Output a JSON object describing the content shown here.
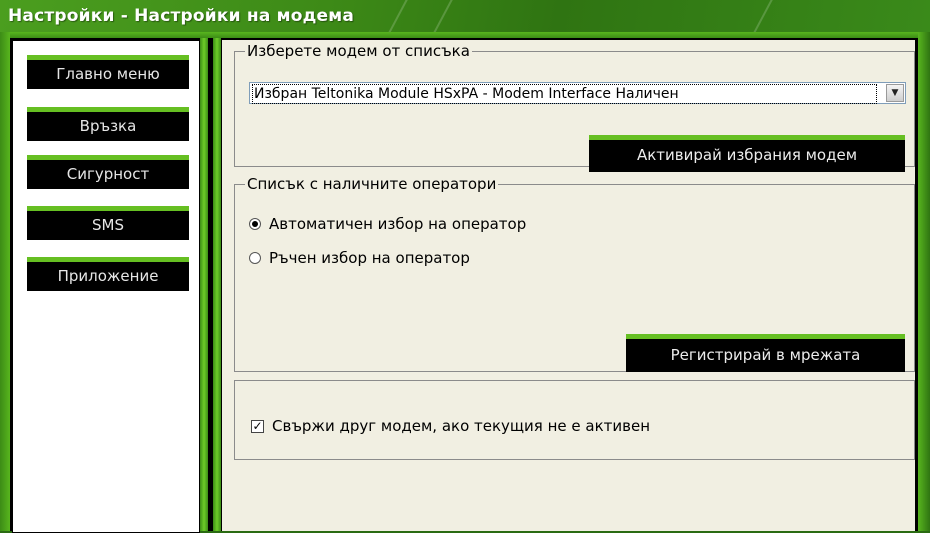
{
  "window": {
    "title": "Настройки - Настройки на модема"
  },
  "sidebar": {
    "items": [
      {
        "label": "Главно меню"
      },
      {
        "label": "Връзка"
      },
      {
        "label": "Сигурност"
      },
      {
        "label": "SMS"
      },
      {
        "label": "Приложение"
      }
    ]
  },
  "modem_group": {
    "legend": "Изберете модем от списъка",
    "selected_modem": "Избран  Teltonika Module HSxPA - Modem Interface  Наличен",
    "activate_label": "Активирай избрания модем"
  },
  "operator_group": {
    "legend": "Списък с наличните оператори",
    "options": [
      {
        "label": "Автоматичен избор на оператор",
        "selected": true
      },
      {
        "label": "Ръчен избор на оператор",
        "selected": false
      }
    ],
    "register_label": "Регистрирай в мрежата"
  },
  "fallback_group": {
    "checkbox_label": "Свържи друг модем, ако текущия не е активен",
    "checked": true
  },
  "colors": {
    "accent_green": "#66bf22",
    "frame_green": "#3c8c16",
    "button_black": "#000000",
    "panel_bg": "#f1efe2"
  }
}
